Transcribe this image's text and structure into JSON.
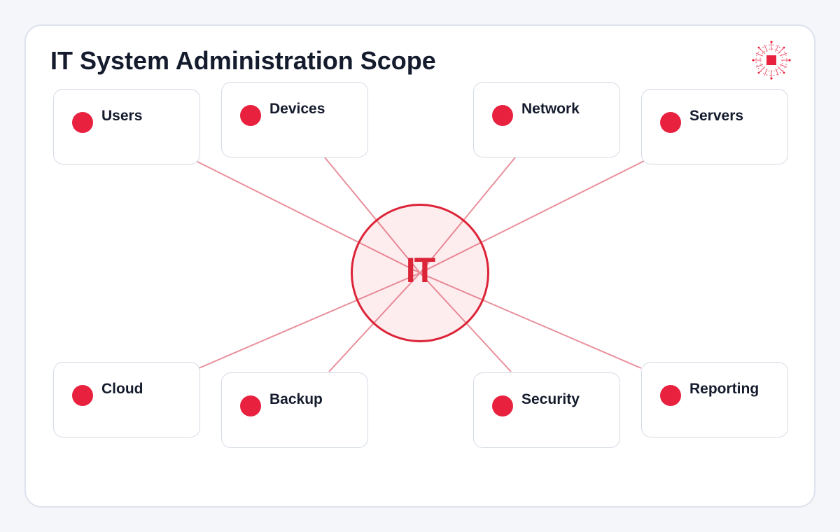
{
  "title": "IT System Administration Scope",
  "hub": {
    "label": "IT"
  },
  "nodes": [
    {
      "id": "users",
      "label": "Users"
    },
    {
      "id": "devices",
      "label": "Devices"
    },
    {
      "id": "network",
      "label": "Network"
    },
    {
      "id": "servers",
      "label": "Servers"
    },
    {
      "id": "cloud",
      "label": "Cloud"
    },
    {
      "id": "backup",
      "label": "Backup"
    },
    {
      "id": "security",
      "label": "Security"
    },
    {
      "id": "reporting",
      "label": "Reporting"
    }
  ],
  "colors": {
    "accent": "#e8213f",
    "hub_stroke": "#dc2438",
    "connector": "#e8909c",
    "title": "#141b2d",
    "card_border": "#dfe2ec"
  },
  "icons": {
    "logo": "circuit-chip-icon"
  }
}
